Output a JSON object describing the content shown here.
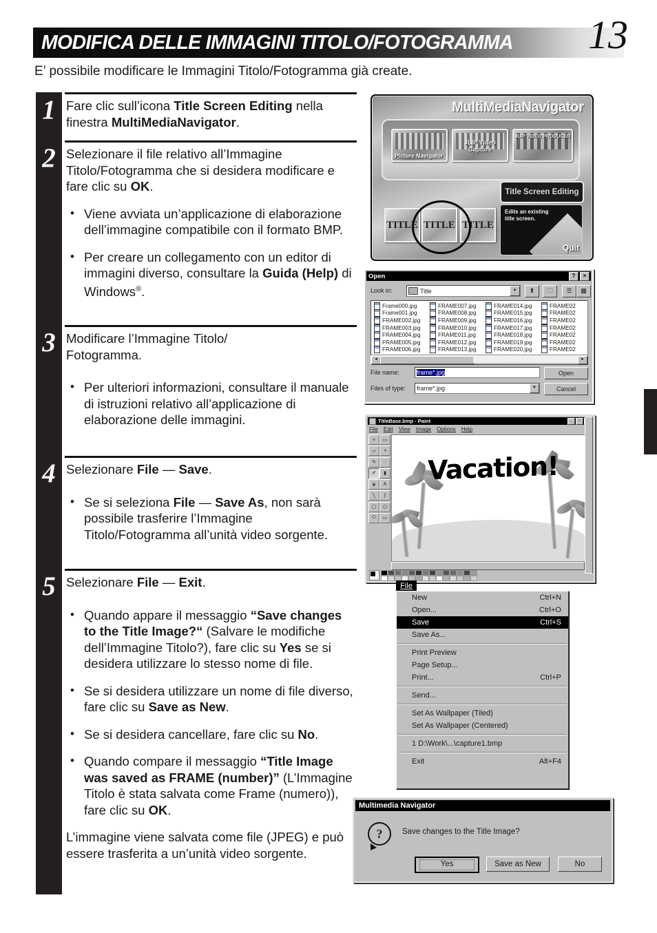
{
  "header": {
    "title": "MODIFICA DELLE IMMAGINI TITOLO/FOTOGRAMMA",
    "page_number": "13"
  },
  "intro": "E’ possibile modificare le Immagini Titolo/Fotogramma già create.",
  "steps": [
    {
      "number": "1",
      "text_parts": [
        "Fare clic sull’icona ",
        "Title Screen Editing",
        " nella finestra ",
        "MultiMediaNavigator",
        "."
      ],
      "bullets": []
    },
    {
      "number": "2",
      "text_parts": [
        "Selezionare il file relativo all’Immagine Titolo/Fotogramma che si desidera modificare e fare clic su ",
        "OK",
        "."
      ],
      "bullets": [
        "Viene avviata un’applicazione di elaborazione dell’immagine compatibile con il formato BMP.",
        "Per creare un collegamento con un editor di immagini diverso, consultare la Guida (Help) di Windows®."
      ]
    },
    {
      "number": "3",
      "text_parts": [
        "Modificare l’Immagine Titolo/Fotogramma."
      ],
      "bullets": [
        "Per ulteriori informazioni, consultare il manuale di istruzioni relativo all’applicazione di elaborazione delle immagini."
      ]
    },
    {
      "number": "4",
      "text_parts": [
        "Selezionare ",
        "File",
        " — ",
        "Save",
        "."
      ],
      "bullets": [
        "Se si seleziona File — Save As, non sarà possibile trasferire l’Immagine Titolo/Fotogramma all’unità video sorgente."
      ]
    },
    {
      "number": "5",
      "text_parts": [
        "Selezionare ",
        "File",
        " — ",
        "Exit",
        "."
      ],
      "bullets": [
        "Quando appare il messaggio “Save changes to the Title Image?“ (Salvare le modifiche dell’Immagine Titolo?), fare clic su Yes se si desidera utilizzare lo stesso nome di file.",
        "Se si desidera utilizzare un nome di file diverso, fare clic su Save as New.",
        "Se si desidera cancellare, fare clic su No.",
        "Quando compare il messaggio “Title Image was saved as FRAME (number)” (L’Immagine Titolo è stata salvata come Frame (numero)), fare clic su OK."
      ],
      "tail": "L’immagine viene salvata come file (JPEG) e può essere trasferita a un’unità video sorgente."
    }
  ],
  "step_text": {
    "s1_a": "Fare clic sull’icona ",
    "s1_b": "Title Screen Editing",
    "s1_c": " nella finestra ",
    "s1_d": "MultiMediaNavigator",
    "s1_e": ".",
    "s2_a": "Selezionare il file relativo all’Immagine Titolo/Fotogramma che si desidera modificare e fare clic su ",
    "s2_b": "OK",
    "s2_c": ".",
    "s2_bullet1": "Viene avviata un’applicazione di elaborazione dell’immagine compatibile con il formato BMP.",
    "s2_bullet2_a": "Per creare un collegamento con un editor di immagini diverso, consultare la ",
    "s2_bullet2_b": "Guida (Help)",
    "s2_bullet2_c": " di Windows",
    "s2_bullet2_sup": "®",
    "s2_bullet2_d": ".",
    "s3_a": "Modificare l’Immagine Titolo/",
    "s3_b": "Fotogramma.",
    "s3_bullet1": "Per ulteriori informazioni, consultare il manuale di istruzioni relativo all’applicazione di elaborazione delle immagini.",
    "s4_a": "Selezionare ",
    "s4_b": "File",
    "s4_c": " — ",
    "s4_d": "Save",
    "s4_e": ".",
    "s4_bullet1_a": "Se si seleziona ",
    "s4_bullet1_b": "File",
    "s4_bullet1_c": " — ",
    "s4_bullet1_d": "Save As",
    "s4_bullet1_e": ", non sarà possibile trasferire l’Immagine Titolo/Fotogramma all’unità video sorgente.",
    "s5_a": "Selezionare ",
    "s5_b": "File",
    "s5_c": " — ",
    "s5_d": "Exit",
    "s5_e": ".",
    "s5_bullet1_a": "Quando appare il messaggio ",
    "s5_bullet1_b": "“Save changes to the Title Image?“",
    "s5_bullet1_c": " (Salvare le modifiche dell’Immagine Titolo?), fare clic su ",
    "s5_bullet1_d": "Yes",
    "s5_bullet1_e": " se si desidera utilizzare lo stesso nome di file.",
    "s5_bullet2_a": "Se si desidera utilizzare un nome di file diverso, fare clic su ",
    "s5_bullet2_b": "Save as New",
    "s5_bullet2_c": ".",
    "s5_bullet3_a": "Se si desidera cancellare, fare clic su ",
    "s5_bullet3_b": "No",
    "s5_bullet3_c": ".",
    "s5_bullet4_a": "Quando compare il messaggio ",
    "s5_bullet4_b": "“Title Image was saved as FRAME (number)”",
    "s5_bullet4_c": " (L’Immagine Titolo è stata salvata come Frame (numero)), fare clic su ",
    "s5_bullet4_d": "OK",
    "s5_bullet4_e": ".",
    "s5_tail": "L’immagine viene salvata come file (JPEG) e può essere trasferita a un’unità video sorgente."
  },
  "mmn": {
    "title": "MultiMediaNavigator",
    "buttons": [
      {
        "label": "Picture Navigator"
      },
      {
        "label": "JLIP Video Capture"
      },
      {
        "label": "JLIP VIDEO PRODUCER"
      }
    ],
    "title_screen_editing": "Title Screen Editing",
    "info_line1": "Edits an existing",
    "info_line2": "title screen.",
    "quit": "Quit",
    "icons": [
      "TITLE",
      "TITLE",
      "TITLE"
    ]
  },
  "open_dialog": {
    "title": "Open",
    "help_btn": "?",
    "close_btn": "×",
    "lookin_label": "Look in:",
    "lookin_value": "Title",
    "files": [
      [
        "Frame000.jpg",
        "Frame001.jpg",
        "FRAME002.jpg",
        "FRAME003.jpg",
        "FRAME004.jpg",
        "FRAME005.jpg",
        "FRAME006.jpg"
      ],
      [
        "FRAME007.jpg",
        "FRAME008.jpg",
        "FRAME009.jpg",
        "FRAME010.jpg",
        "FRAME011.jpg",
        "FRAME012.jpg",
        "FRAME013.jpg"
      ],
      [
        "FRAME014.jpg",
        "FRAME015.jpg",
        "FRAME016.jpg",
        "FRAME017.jpg",
        "FRAME018.jpg",
        "FRAME019.jpg",
        "FRAME020.jpg"
      ],
      [
        "FRAME02",
        "FRAME02",
        "FRAME02",
        "FRAME02",
        "FRAME02",
        "FRAME02",
        "FRAME02"
      ]
    ],
    "filename_label": "File name:",
    "filename_value": "frame*.jpg",
    "filetype_label": "Files of type:",
    "filetype_value": "frame*.jpg",
    "open_button": "Open",
    "cancel_button": "Cancel"
  },
  "paint": {
    "title": "TitleBase.bmp - Paint",
    "menu": [
      "File",
      "Edit",
      "View",
      "Image",
      "Options",
      "Help"
    ],
    "canvas_text": "Vacation!",
    "min_btn": "_",
    "max_btn": "□",
    "close_btn": "×"
  },
  "file_menu": {
    "caption": "File",
    "items": [
      {
        "label": "New",
        "accel": "Ctrl+N",
        "selected": false
      },
      {
        "label": "Open...",
        "accel": "Ctrl+O",
        "selected": false
      },
      {
        "label": "Save",
        "accel": "Ctrl+S",
        "selected": true
      },
      {
        "label": "Save As...",
        "accel": "",
        "selected": false
      },
      {
        "sep": true
      },
      {
        "label": "Print Preview",
        "accel": "",
        "selected": false
      },
      {
        "label": "Page Setup...",
        "accel": "",
        "selected": false
      },
      {
        "label": "Print...",
        "accel": "Ctrl+P",
        "selected": false
      },
      {
        "sep": true
      },
      {
        "label": "Send...",
        "accel": "",
        "selected": false
      },
      {
        "sep": true
      },
      {
        "label": "Set As Wallpaper (Tiled)",
        "accel": "",
        "selected": false
      },
      {
        "label": "Set As Wallpaper (Centered)",
        "accel": "",
        "selected": false
      },
      {
        "sep": true
      },
      {
        "label": "1 D:\\Work\\...\\capture1.bmp",
        "accel": "",
        "selected": false
      },
      {
        "sep": true
      },
      {
        "label": "Exit",
        "accel": "Alt+F4",
        "selected": false
      }
    ]
  },
  "message_box": {
    "title": "Multimedia Navigator",
    "icon": "?",
    "text": "Save changes to the Title Image?",
    "buttons": [
      "Yes",
      "Save as New",
      "No"
    ]
  },
  "colors": {
    "ink": "#231f20",
    "header_dark": "#0d0d0d",
    "win_face": "#c0c0c0",
    "win_titlebar": "#000000",
    "highlight": "#000080"
  }
}
